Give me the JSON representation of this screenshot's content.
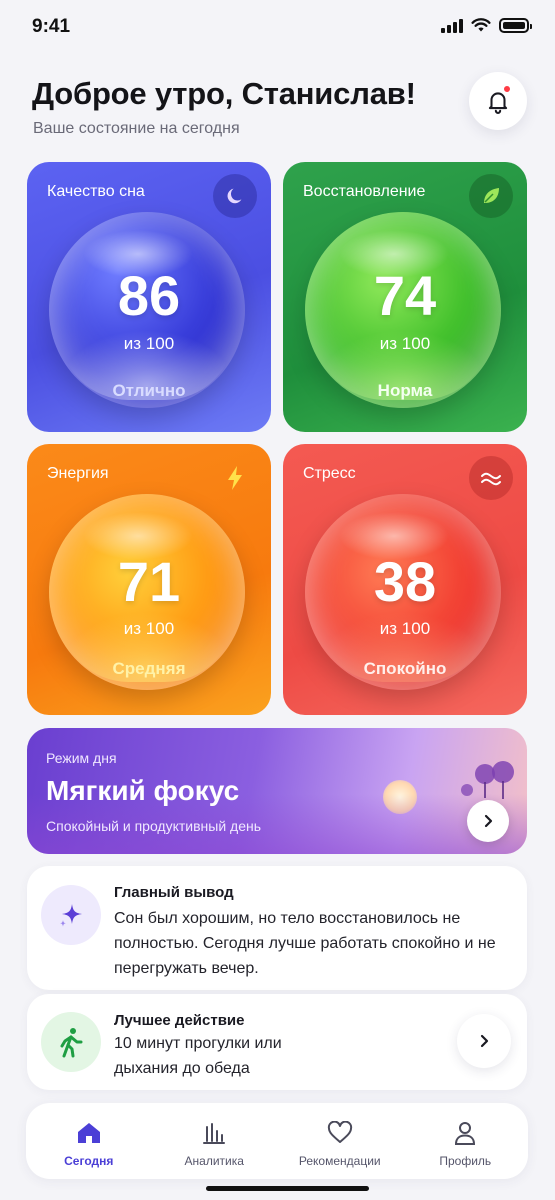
{
  "status_bar": {
    "time": "9:41"
  },
  "header": {
    "greeting": "Доброе утро, Станислав!",
    "subtitle": "Ваше состояние на сегодня"
  },
  "metrics": [
    {
      "title": "Качество сна",
      "score": "86",
      "of": "из 100",
      "status": "Отлично",
      "icon": "moon-icon"
    },
    {
      "title": "Восстановление",
      "score": "74",
      "of": "из 100",
      "status": "Норма",
      "icon": "leaf-icon"
    },
    {
      "title": "Энергия",
      "score": "71",
      "of": "из 100",
      "status": "Средняя",
      "icon": "lightning-icon"
    },
    {
      "title": "Стресс",
      "score": "38",
      "of": "из 100",
      "status": "Спокойно",
      "icon": "waves-icon"
    }
  ],
  "day_mode": {
    "label": "Режим дня",
    "title": "Мягкий фокус",
    "subtitle": "Спокойный и продуктивный день"
  },
  "insight": {
    "title": "Главный вывод",
    "text": "Сон был хорошим, но тело восстановилось не полностью. Сегодня лучше работать спокойно и не перегружать вечер."
  },
  "best_action": {
    "title": "Лучшее действие",
    "text": "10 минут прогулки или дыхания до обеда"
  },
  "nav": [
    {
      "label": "Сегодня",
      "icon": "home-icon",
      "active": true
    },
    {
      "label": "Аналитика",
      "icon": "chart-icon",
      "active": false
    },
    {
      "label": "Рекомендации",
      "icon": "heart-icon",
      "active": false
    },
    {
      "label": "Профиль",
      "icon": "user-icon",
      "active": false
    }
  ],
  "colors": {
    "accent": "#4b3fd6",
    "sleep": "#4b4fe2",
    "recovery": "#1f8f3c",
    "energy": "#f77a0e",
    "stress": "#ee4b45",
    "notification_dot": "#ff3b44"
  }
}
